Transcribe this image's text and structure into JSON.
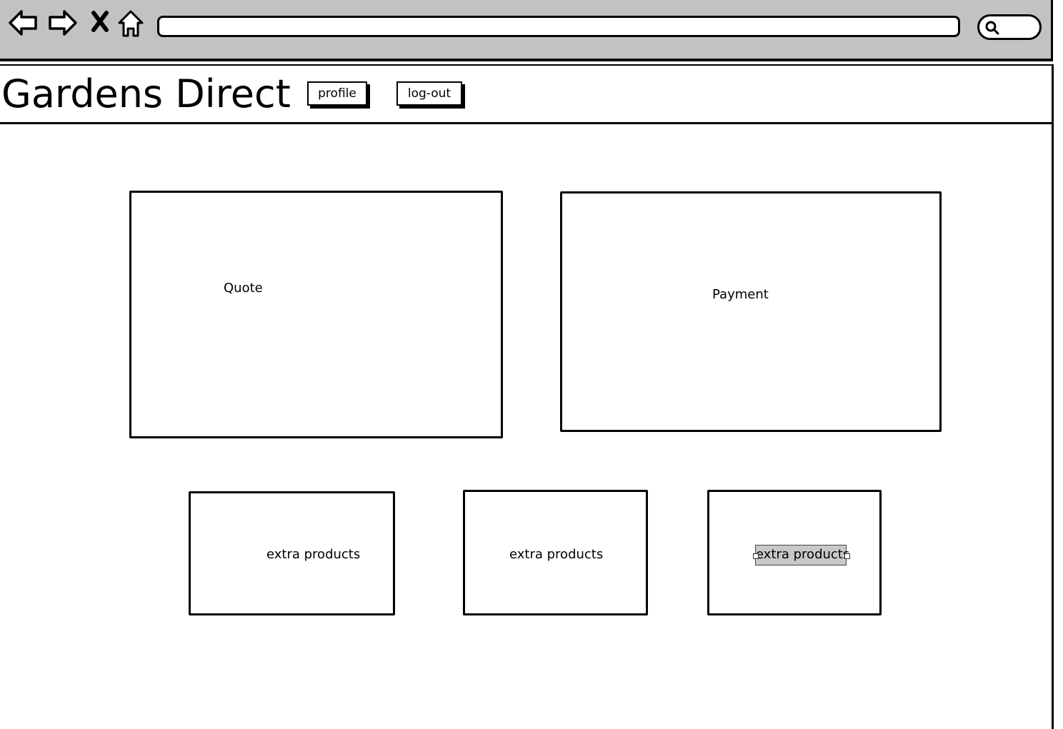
{
  "browser": {
    "icons": [
      "back-arrow-icon",
      "forward-arrow-icon",
      "close-x-icon",
      "home-icon",
      "search-icon"
    ],
    "url": "",
    "search": ""
  },
  "header": {
    "title": "Gardens Direct",
    "profile_label": "profile",
    "logout_label": "log-out"
  },
  "main": {
    "quote_label": "Quote",
    "payment_label": "Payment",
    "extras": [
      {
        "label": "extra products"
      },
      {
        "label": "extra products"
      },
      {
        "label": "extra products",
        "selected": true
      }
    ]
  },
  "colors": {
    "chrome": "#c2c2c2",
    "selection": "#c8c8c8"
  }
}
